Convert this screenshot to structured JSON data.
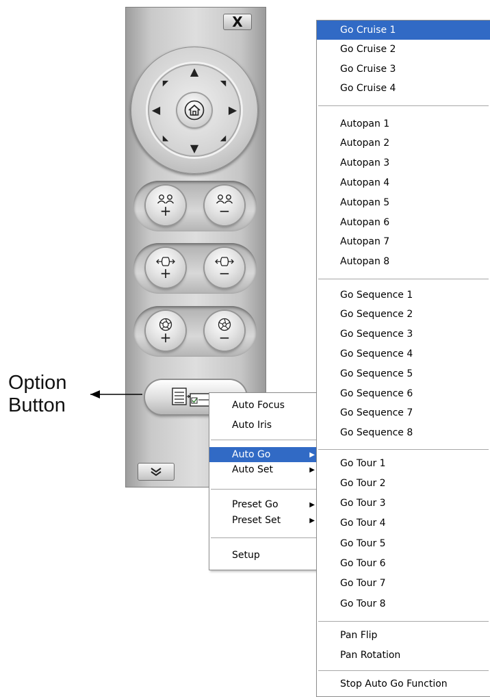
{
  "annotation": {
    "line1": "Option",
    "line2": "Button"
  },
  "panel": {
    "close_label": "X",
    "icons": {
      "up": "▲",
      "down": "▼",
      "left": "◀",
      "right": "▶",
      "up_left": "◤",
      "up_right": "◥",
      "down_left": "◣",
      "down_right": "◢",
      "zoom_in_symbol": "ጸ",
      "plus": "+",
      "minus": "−"
    }
  },
  "submenu": {
    "items": [
      {
        "label": "Auto Focus",
        "arrow": ""
      },
      {
        "label": "Auto Iris",
        "arrow": ""
      },
      {
        "label": "Auto Go",
        "arrow": "▶"
      },
      {
        "label": "Auto Set",
        "arrow": "▶"
      },
      {
        "label": "Preset Go",
        "arrow": "▶"
      },
      {
        "label": "Preset Set",
        "arrow": "▶"
      },
      {
        "label": "Setup",
        "arrow": ""
      }
    ],
    "highlighted": "Auto Go"
  },
  "auto_go_menu": {
    "items": [
      "Go Cruise 1",
      "Go Cruise 2",
      "Go Cruise 3",
      "Go Cruise 4",
      "Autopan 1",
      "Autopan 2",
      "Autopan 3",
      "Autopan 4",
      "Autopan 5",
      "Autopan 6",
      "Autopan 7",
      "Autopan 8",
      "Go Sequence 1",
      "Go Sequence 2",
      "Go Sequence 3",
      "Go Sequence 4",
      "Go Sequence 5",
      "Go Sequence 6",
      "Go Sequence 7",
      "Go Sequence 8",
      "Go Tour 1",
      "Go Tour 2",
      "Go Tour 3",
      "Go Tour 4",
      "Go Tour 5",
      "Go Tour 6",
      "Go Tour 7",
      "Go Tour 8",
      "Pan Flip",
      "Pan Rotation",
      "Stop Auto Go Function"
    ],
    "highlighted": "Go Cruise 1"
  },
  "colors": {
    "highlight": "#316ac5",
    "highlight_text": "#ffffff"
  }
}
